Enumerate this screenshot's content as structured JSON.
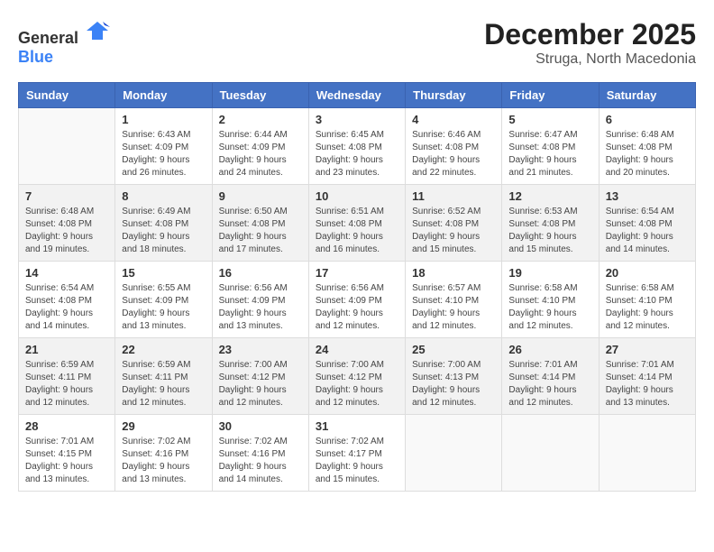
{
  "header": {
    "logo_general": "General",
    "logo_blue": "Blue",
    "month": "December 2025",
    "location": "Struga, North Macedonia"
  },
  "weekdays": [
    "Sunday",
    "Monday",
    "Tuesday",
    "Wednesday",
    "Thursday",
    "Friday",
    "Saturday"
  ],
  "weeks": [
    [
      {
        "day": "",
        "info": ""
      },
      {
        "day": "1",
        "info": "Sunrise: 6:43 AM\nSunset: 4:09 PM\nDaylight: 9 hours\nand 26 minutes."
      },
      {
        "day": "2",
        "info": "Sunrise: 6:44 AM\nSunset: 4:09 PM\nDaylight: 9 hours\nand 24 minutes."
      },
      {
        "day": "3",
        "info": "Sunrise: 6:45 AM\nSunset: 4:08 PM\nDaylight: 9 hours\nand 23 minutes."
      },
      {
        "day": "4",
        "info": "Sunrise: 6:46 AM\nSunset: 4:08 PM\nDaylight: 9 hours\nand 22 minutes."
      },
      {
        "day": "5",
        "info": "Sunrise: 6:47 AM\nSunset: 4:08 PM\nDaylight: 9 hours\nand 21 minutes."
      },
      {
        "day": "6",
        "info": "Sunrise: 6:48 AM\nSunset: 4:08 PM\nDaylight: 9 hours\nand 20 minutes."
      }
    ],
    [
      {
        "day": "7",
        "info": "Sunrise: 6:48 AM\nSunset: 4:08 PM\nDaylight: 9 hours\nand 19 minutes."
      },
      {
        "day": "8",
        "info": "Sunrise: 6:49 AM\nSunset: 4:08 PM\nDaylight: 9 hours\nand 18 minutes."
      },
      {
        "day": "9",
        "info": "Sunrise: 6:50 AM\nSunset: 4:08 PM\nDaylight: 9 hours\nand 17 minutes."
      },
      {
        "day": "10",
        "info": "Sunrise: 6:51 AM\nSunset: 4:08 PM\nDaylight: 9 hours\nand 16 minutes."
      },
      {
        "day": "11",
        "info": "Sunrise: 6:52 AM\nSunset: 4:08 PM\nDaylight: 9 hours\nand 15 minutes."
      },
      {
        "day": "12",
        "info": "Sunrise: 6:53 AM\nSunset: 4:08 PM\nDaylight: 9 hours\nand 15 minutes."
      },
      {
        "day": "13",
        "info": "Sunrise: 6:54 AM\nSunset: 4:08 PM\nDaylight: 9 hours\nand 14 minutes."
      }
    ],
    [
      {
        "day": "14",
        "info": "Sunrise: 6:54 AM\nSunset: 4:08 PM\nDaylight: 9 hours\nand 14 minutes."
      },
      {
        "day": "15",
        "info": "Sunrise: 6:55 AM\nSunset: 4:09 PM\nDaylight: 9 hours\nand 13 minutes."
      },
      {
        "day": "16",
        "info": "Sunrise: 6:56 AM\nSunset: 4:09 PM\nDaylight: 9 hours\nand 13 minutes."
      },
      {
        "day": "17",
        "info": "Sunrise: 6:56 AM\nSunset: 4:09 PM\nDaylight: 9 hours\nand 12 minutes."
      },
      {
        "day": "18",
        "info": "Sunrise: 6:57 AM\nSunset: 4:10 PM\nDaylight: 9 hours\nand 12 minutes."
      },
      {
        "day": "19",
        "info": "Sunrise: 6:58 AM\nSunset: 4:10 PM\nDaylight: 9 hours\nand 12 minutes."
      },
      {
        "day": "20",
        "info": "Sunrise: 6:58 AM\nSunset: 4:10 PM\nDaylight: 9 hours\nand 12 minutes."
      }
    ],
    [
      {
        "day": "21",
        "info": "Sunrise: 6:59 AM\nSunset: 4:11 PM\nDaylight: 9 hours\nand 12 minutes."
      },
      {
        "day": "22",
        "info": "Sunrise: 6:59 AM\nSunset: 4:11 PM\nDaylight: 9 hours\nand 12 minutes."
      },
      {
        "day": "23",
        "info": "Sunrise: 7:00 AM\nSunset: 4:12 PM\nDaylight: 9 hours\nand 12 minutes."
      },
      {
        "day": "24",
        "info": "Sunrise: 7:00 AM\nSunset: 4:12 PM\nDaylight: 9 hours\nand 12 minutes."
      },
      {
        "day": "25",
        "info": "Sunrise: 7:00 AM\nSunset: 4:13 PM\nDaylight: 9 hours\nand 12 minutes."
      },
      {
        "day": "26",
        "info": "Sunrise: 7:01 AM\nSunset: 4:14 PM\nDaylight: 9 hours\nand 12 minutes."
      },
      {
        "day": "27",
        "info": "Sunrise: 7:01 AM\nSunset: 4:14 PM\nDaylight: 9 hours\nand 13 minutes."
      }
    ],
    [
      {
        "day": "28",
        "info": "Sunrise: 7:01 AM\nSunset: 4:15 PM\nDaylight: 9 hours\nand 13 minutes."
      },
      {
        "day": "29",
        "info": "Sunrise: 7:02 AM\nSunset: 4:16 PM\nDaylight: 9 hours\nand 13 minutes."
      },
      {
        "day": "30",
        "info": "Sunrise: 7:02 AM\nSunset: 4:16 PM\nDaylight: 9 hours\nand 14 minutes."
      },
      {
        "day": "31",
        "info": "Sunrise: 7:02 AM\nSunset: 4:17 PM\nDaylight: 9 hours\nand 15 minutes."
      },
      {
        "day": "",
        "info": ""
      },
      {
        "day": "",
        "info": ""
      },
      {
        "day": "",
        "info": ""
      }
    ]
  ]
}
